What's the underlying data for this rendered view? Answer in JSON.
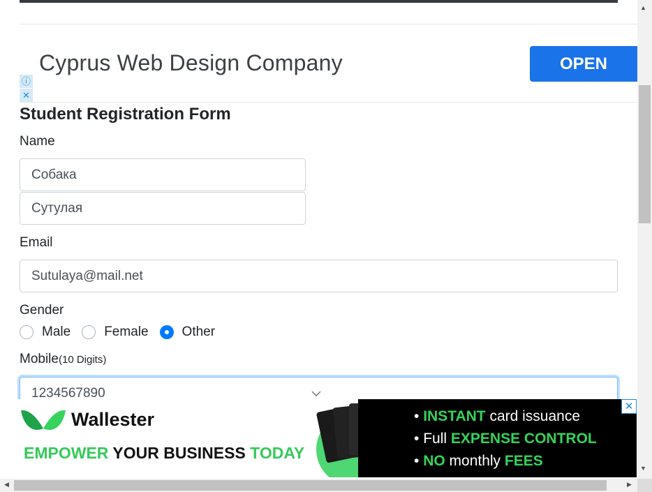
{
  "ad_top": {
    "title": "Cyprus Web Design Company",
    "open_label": "OPEN",
    "info_icon": "ⓘ",
    "close_icon": "✕"
  },
  "form": {
    "title": "Student Registration Form",
    "name_label": "Name",
    "first_name_value": "Собака",
    "last_name_value": "Сутулая",
    "email_label": "Email",
    "email_value": "Sutulaya@mail.net",
    "gender_label": "Gender",
    "gender_options": [
      "Male",
      "Female",
      "Other"
    ],
    "gender_selected": "Other",
    "mobile_label": "Mobile",
    "mobile_hint": "(10 Digits)",
    "mobile_value": "1234567890"
  },
  "ad_bottom": {
    "brand": "Wallester",
    "slogan_a": "EMPOWER",
    "slogan_b": " YOUR BUSINESS ",
    "slogan_c": "TODAY",
    "bullet1_a": "INSTANT",
    "bullet1_b": " card issuance",
    "bullet2_a": "Full ",
    "bullet2_b": "EXPENSE CONTROL",
    "bullet3_a": "NO",
    "bullet3_b": " monthly ",
    "bullet3_c": "FEES",
    "close_icon": "✕"
  },
  "colors": {
    "accent": "#007bff",
    "ad_button": "#1a73e8",
    "ad_green": "#35c95a"
  }
}
